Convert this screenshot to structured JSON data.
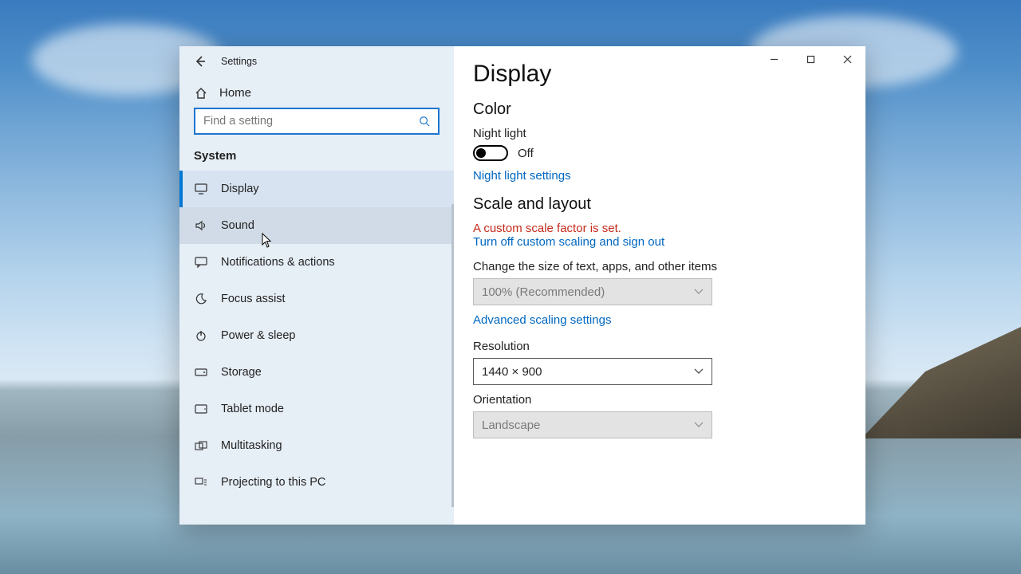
{
  "window": {
    "title": "Settings"
  },
  "sidebar": {
    "home": "Home",
    "search_placeholder": "Find a setting",
    "section": "System",
    "items": [
      {
        "label": "Display",
        "icon": "monitor-icon",
        "state": "active"
      },
      {
        "label": "Sound",
        "icon": "speaker-icon",
        "state": "hover"
      },
      {
        "label": "Notifications & actions",
        "icon": "message-icon",
        "state": ""
      },
      {
        "label": "Focus assist",
        "icon": "moon-icon",
        "state": ""
      },
      {
        "label": "Power & sleep",
        "icon": "power-icon",
        "state": ""
      },
      {
        "label": "Storage",
        "icon": "drive-icon",
        "state": ""
      },
      {
        "label": "Tablet mode",
        "icon": "tablet-icon",
        "state": ""
      },
      {
        "label": "Multitasking",
        "icon": "multitask-icon",
        "state": ""
      },
      {
        "label": "Projecting to this PC",
        "icon": "project-icon",
        "state": ""
      }
    ]
  },
  "main": {
    "title": "Display",
    "color_heading": "Color",
    "night_light_label": "Night light",
    "night_light_state": "Off",
    "night_light_settings": "Night light settings",
    "scale_heading": "Scale and layout",
    "custom_scale_warning": "A custom scale factor is set.",
    "turn_off_custom": "Turn off custom scaling and sign out",
    "change_size_label": "Change the size of text, apps, and other items",
    "scale_value": "100% (Recommended)",
    "advanced_scaling": "Advanced scaling settings",
    "resolution_label": "Resolution",
    "resolution_value": "1440 × 900",
    "orientation_label": "Orientation",
    "orientation_value": "Landscape"
  }
}
